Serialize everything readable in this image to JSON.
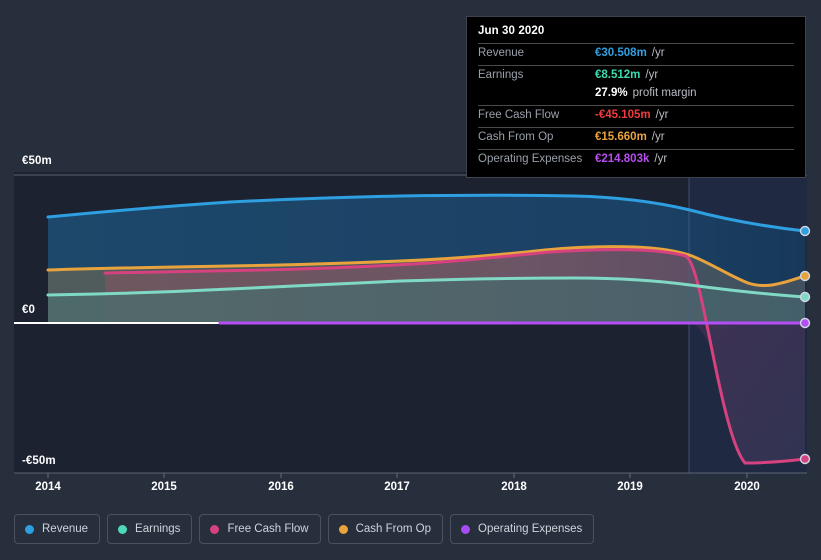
{
  "tooltip": {
    "date": "Jun 30 2020",
    "rows": [
      {
        "name": "Revenue",
        "value": "€30.508m",
        "unit": "/yr",
        "color": "#2e9fe0"
      },
      {
        "name": "Earnings",
        "value": "€8.512m",
        "unit": "/yr",
        "color": "#3ddcb0"
      },
      {
        "name": "",
        "value": "27.9%",
        "unit": "profit margin",
        "color": "#ffffff"
      },
      {
        "name": "Free Cash Flow",
        "value": "-€45.105m",
        "unit": "/yr",
        "color": "#f03c3c"
      },
      {
        "name": "Cash From Op",
        "value": "€15.660m",
        "unit": "/yr",
        "color": "#e8a33d"
      },
      {
        "name": "Operating Expenses",
        "value": "€214.803k",
        "unit": "/yr",
        "color": "#b84ef0"
      }
    ]
  },
  "legend": {
    "items": [
      {
        "label": "Revenue",
        "color": "#2e9fe0"
      },
      {
        "label": "Earnings",
        "color": "#4fd9b8"
      },
      {
        "label": "Free Cash Flow",
        "color": "#d6417f"
      },
      {
        "label": "Cash From Op",
        "color": "#e8a33d"
      },
      {
        "label": "Operating Expenses",
        "color": "#a64cf0"
      }
    ]
  },
  "axes": {
    "y_top": "€50m",
    "y_zero": "€0",
    "y_bottom": "-€50m",
    "x_2014": "2014",
    "x_2015": "2015",
    "x_2016": "2016",
    "x_2017": "2017",
    "x_2018": "2018",
    "x_2019": "2019",
    "x_2020": "2020"
  },
  "chart_data": {
    "type": "area",
    "title": "",
    "xlabel": "",
    "ylabel": "",
    "ylim": [
      -50,
      50
    ],
    "yticks": [
      50,
      0,
      -50
    ],
    "ytick_labels": [
      "€50m",
      "€0",
      "-€50m"
    ],
    "currency": "EUR",
    "units": "millions per year",
    "grid": true,
    "legend_position": "bottom",
    "x": [
      "2014.0",
      "2014.5",
      "2015.0",
      "2015.5",
      "2016.0",
      "2016.5",
      "2017.0",
      "2017.5",
      "2018.0",
      "2018.5",
      "2019.0",
      "2019.5",
      "2020.0",
      "2020.5"
    ],
    "xtick_labels": [
      "2014",
      "2015",
      "2016",
      "2017",
      "2018",
      "2019",
      "2020"
    ],
    "series": [
      {
        "name": "Revenue",
        "color": "#2e9fe0",
        "values": [
          28.5,
          30.5,
          32.0,
          33.2,
          34.0,
          34.4,
          34.7,
          34.8,
          34.8,
          34.6,
          34.0,
          32.6,
          31.1,
          30.5
        ]
      },
      {
        "name": "Earnings",
        "color": "#4fd9b8",
        "values": [
          5.0,
          5.2,
          5.6,
          6.1,
          6.7,
          7.2,
          7.6,
          7.9,
          8.0,
          8.0,
          7.9,
          7.7,
          8.2,
          8.5
        ]
      },
      {
        "name": "Free Cash Flow",
        "color": "#d6417f",
        "values": [
          null,
          13.0,
          13.1,
          13.3,
          13.6,
          14.0,
          14.6,
          15.1,
          15.3,
          15.2,
          14.9,
          8.0,
          -45.0,
          -45.1
        ]
      },
      {
        "name": "Cash From Op",
        "color": "#e8a33d",
        "values": [
          13.6,
          13.9,
          14.0,
          14.1,
          14.3,
          14.6,
          15.0,
          15.6,
          16.4,
          16.2,
          16.0,
          13.2,
          14.5,
          15.7
        ]
      },
      {
        "name": "Operating Expenses",
        "color": "#a64cf0",
        "values": [
          null,
          null,
          null,
          0.21,
          0.21,
          0.21,
          0.21,
          0.21,
          0.21,
          0.21,
          0.21,
          0.21,
          0.21,
          0.215
        ]
      }
    ],
    "highlighted_point": {
      "date": "Jun 30 2020",
      "revenue": 30.508,
      "earnings": 8.512,
      "profit_margin_pct": 27.9,
      "free_cash_flow": -45.105,
      "cash_from_op": 15.66,
      "operating_expenses": 0.214803
    }
  }
}
